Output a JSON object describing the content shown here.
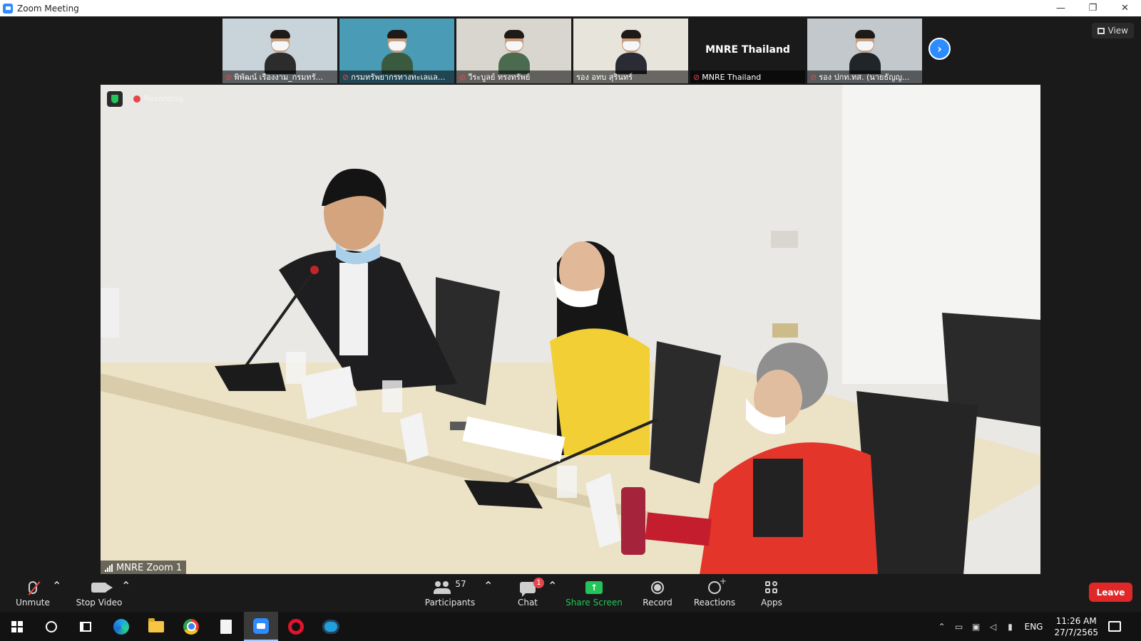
{
  "window": {
    "title": "Zoom Meeting",
    "controls": [
      "—",
      "❐",
      "✕"
    ]
  },
  "thumbnails": [
    {
      "name": "พิพัฒน์ เรืองงาม_กรมทรั...",
      "muted": true,
      "bg": "#c9d3da",
      "shirt": "#2c2c2c"
    },
    {
      "name": "กรมทรัพยากรทางทะเลแล...",
      "muted": true,
      "bg": "#4a9bb5",
      "shirt": "#3a5a40"
    },
    {
      "name": "วีระบูลย์ ทรงทรัพย์",
      "muted": true,
      "bg": "#d9d6cf",
      "shirt": "#4b6b50"
    },
    {
      "name": "รอง อทบ สุรินทร์",
      "muted": false,
      "bg": "#e7e4dc",
      "shirt": "#2b2b33"
    },
    {
      "name": "MNRE Thailand",
      "muted": true,
      "big_text": "MNRE Thailand"
    },
    {
      "name": "รอง ปกท.ทส. (นายธัญญ...",
      "muted": true,
      "bg": "#c2c8cc",
      "shirt": "#1f2528"
    }
  ],
  "view_button": "View",
  "main_video": {
    "recording_label": "Recording",
    "participant_name": "MNRE Zoom 1"
  },
  "toolbar": {
    "unmute": "Unmute",
    "stop_video": "Stop Video",
    "participants": "Participants",
    "participant_count": "57",
    "chat": "Chat",
    "chat_badge": "1",
    "share_screen": "Share Screen",
    "record": "Record",
    "reactions": "Reactions",
    "apps": "Apps",
    "leave": "Leave"
  },
  "taskbar": {
    "apps": [
      "windows-start",
      "cortana",
      "task-view",
      "edge",
      "file-explorer",
      "chrome",
      "notepad",
      "zoom",
      "opera",
      "webex"
    ],
    "language": "ENG",
    "time": "11:26 AM",
    "date": "27/7/2565"
  },
  "colors": {
    "accent": "#2d8cff",
    "leave": "#e02828",
    "share": "#23c45a",
    "muted": "#e84848"
  }
}
